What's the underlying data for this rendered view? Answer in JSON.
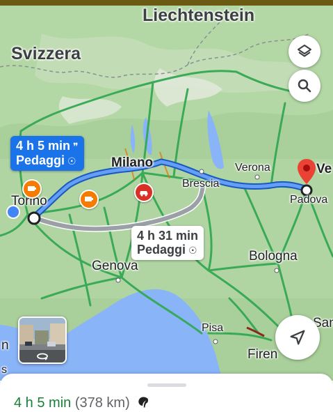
{
  "map": {
    "places": {
      "liechtenstein": "Liechtenstein",
      "svizzera": "Svizzera",
      "milano": "Milano",
      "verona": "Verona",
      "brescia": "Brescia",
      "bologna": "Bologna",
      "genova": "Genova",
      "pisa": "Pisa",
      "torino": "Torino",
      "padova": "Padova",
      "firenze_partial": "Firen",
      "venezia_partial": "Ve",
      "san_partial": "San",
      "left_partial": "n",
      "bottom_partial": "s"
    },
    "routes": {
      "selected": {
        "time": "4 h 5 min",
        "toll": "Pedaggi",
        "color": "#1a73e8"
      },
      "alternative": {
        "time": "4 h 31 min",
        "toll": "Pedaggi",
        "color": "#9aa0a6"
      }
    },
    "buttons": {
      "layers_icon": "layers-icon",
      "search_icon": "search-icon",
      "navigate_icon": "navigation-arrow-icon",
      "street_view_icon": "street-view-360-icon"
    },
    "colors": {
      "land": "#a9cf9a",
      "water": "#8ab4f8",
      "traffic_free": "#34a853",
      "traffic_slow": "#8c2a1c",
      "pin": "#ea4335",
      "camera": "#f57c00"
    }
  },
  "sheet": {
    "time": "4 h 5 min",
    "distance": "(378 km)",
    "eco_icon": "eco-route-icon"
  }
}
